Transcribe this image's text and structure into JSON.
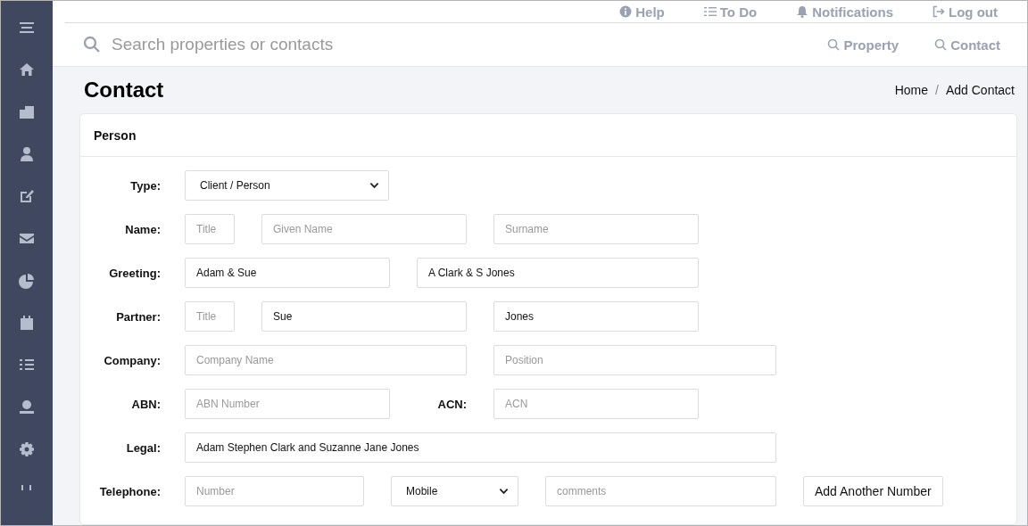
{
  "top_nav": [
    {
      "label": "Help"
    },
    {
      "label": "To Do"
    },
    {
      "label": "Notifications"
    },
    {
      "label": "Log out"
    }
  ],
  "search": {
    "placeholder": "Search properties or contacts"
  },
  "search_buttons": [
    {
      "label": "Property"
    },
    {
      "label": "Contact"
    }
  ],
  "page_title": "Contact",
  "breadcrumb": [
    "Home",
    "Add Contact"
  ],
  "breadcrumb_separator": "/",
  "card": {
    "title": "Person",
    "rows": [
      {
        "label": "Type:",
        "fields": [
          {
            "kind": "select",
            "value": "Client / Person"
          }
        ]
      },
      {
        "label": "Name:",
        "fields": [
          {
            "kind": "input",
            "placeholder": "Title"
          },
          {
            "kind": "input",
            "placeholder": "Given Name"
          },
          {
            "kind": "input",
            "placeholder": "Surname"
          }
        ]
      },
      {
        "label": "Greeting:",
        "fields": [
          {
            "kind": "input",
            "value": "Adam & Sue"
          },
          {
            "kind": "input",
            "value": "A Clark & S Jones"
          }
        ]
      },
      {
        "label": "Partner:",
        "fields": [
          {
            "kind": "input",
            "placeholder": "Title"
          },
          {
            "kind": "input",
            "value": "Sue"
          },
          {
            "kind": "input",
            "value": "Jones"
          }
        ]
      },
      {
        "label": "Company:",
        "fields": [
          {
            "kind": "input",
            "placeholder": "Company Name"
          },
          {
            "kind": "input",
            "placeholder": "Position"
          }
        ]
      },
      {
        "label": "ABN:",
        "fields": [
          {
            "kind": "input",
            "placeholder": "ABN Number"
          },
          {
            "kind": "label",
            "text": "ACN:"
          },
          {
            "kind": "input",
            "placeholder": "ACN"
          }
        ]
      },
      {
        "label": "Legal:",
        "fields": [
          {
            "kind": "input",
            "value": "Adam Stephen Clark and Suzanne Jane Jones"
          }
        ]
      },
      {
        "label": "Telephone:",
        "fields": [
          {
            "kind": "input",
            "placeholder": "Number"
          },
          {
            "kind": "select",
            "value": "Mobile"
          },
          {
            "kind": "input",
            "placeholder": "comments"
          },
          {
            "kind": "button",
            "label": "Add Another Number"
          }
        ]
      }
    ]
  }
}
